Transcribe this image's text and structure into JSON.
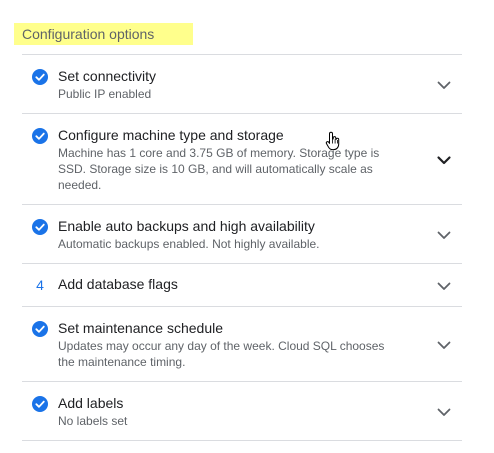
{
  "header": {
    "title": "Configuration options"
  },
  "options": [
    {
      "step": "check",
      "title": "Set connectivity",
      "description": "Public IP enabled",
      "expanded": false
    },
    {
      "step": "check",
      "title": "Configure machine type and storage",
      "description": "Machine has 1 core and 3.75 GB of memory. Storage type is SSD. Storage size is 10 GB, and will automatically scale as needed.",
      "expanded": true
    },
    {
      "step": "check",
      "title": "Enable auto backups and high availability",
      "description": "Automatic backups enabled. Not highly available.",
      "expanded": false
    },
    {
      "step": "4",
      "title": "Add database flags",
      "description": "",
      "expanded": false
    },
    {
      "step": "check",
      "title": "Set maintenance schedule",
      "description": "Updates may occur any day of the week. Cloud SQL chooses the maintenance timing.",
      "expanded": false
    },
    {
      "step": "check",
      "title": "Add labels",
      "description": "No labels set",
      "expanded": false
    }
  ],
  "colors": {
    "accent": "#1a73e8",
    "highlight": "#ffff8c",
    "chevron_collapsed": "#5f6368",
    "chevron_active": "#202124"
  },
  "icons": {
    "done": "check-circle-icon",
    "expand": "chevron-down-icon",
    "pointer": "hand-pointer-icon"
  }
}
